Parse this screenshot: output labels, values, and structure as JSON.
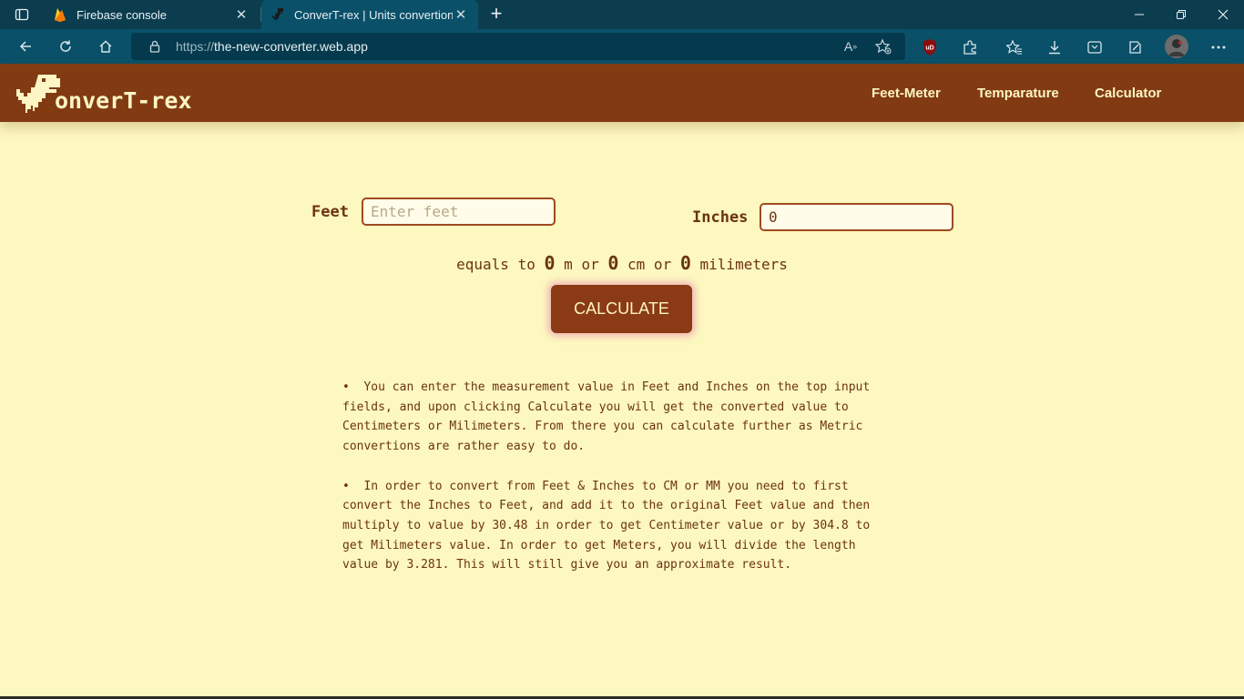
{
  "browser": {
    "tabs": [
      {
        "title": "Firebase console",
        "icon": "firebase-icon"
      },
      {
        "title": "ConverT-rex | Units convertion w",
        "icon": "trex-icon",
        "active": true
      }
    ],
    "url_protocol": "https://",
    "url_host": "the-new-converter.web.app",
    "extension_badge": "uD"
  },
  "site": {
    "logo_text": "onverT-rex",
    "nav": [
      "Feet-Meter",
      "Temparature",
      "Calculator"
    ],
    "colors": {
      "header": "#813a12",
      "background": "#fdf7c0",
      "text": "#6b3412",
      "accent_glow": "#e478aa"
    }
  },
  "form": {
    "feet_label": "Feet",
    "feet_placeholder": "Enter feet",
    "inches_label": "Inches",
    "inches_value": "0"
  },
  "result": {
    "prefix": "equals to",
    "meters": "0",
    "meters_unit": "m or",
    "cm": "0",
    "cm_unit": "cm or",
    "mm": "0",
    "mm_unit": "milimeters"
  },
  "calculate_label": "CALCULATE",
  "notes": [
    "You can enter the measurement value in Feet and Inches on the top input fields, and upon clicking Calculate you will get the converted value to Centimeters or Milimeters. From there you can calculate further as Metric convertions are rather easy to do.",
    "In order to convert from Feet & Inches to CM or MM you need to first convert the Inches to Feet, and add it to the original Feet value and then multiply to value by 30.48 in order to get Centimeter value or by 304.8 to get Milimeters value. In order to get Meters, you will divide the length value by 3.281. This will still give you an approximate result."
  ]
}
